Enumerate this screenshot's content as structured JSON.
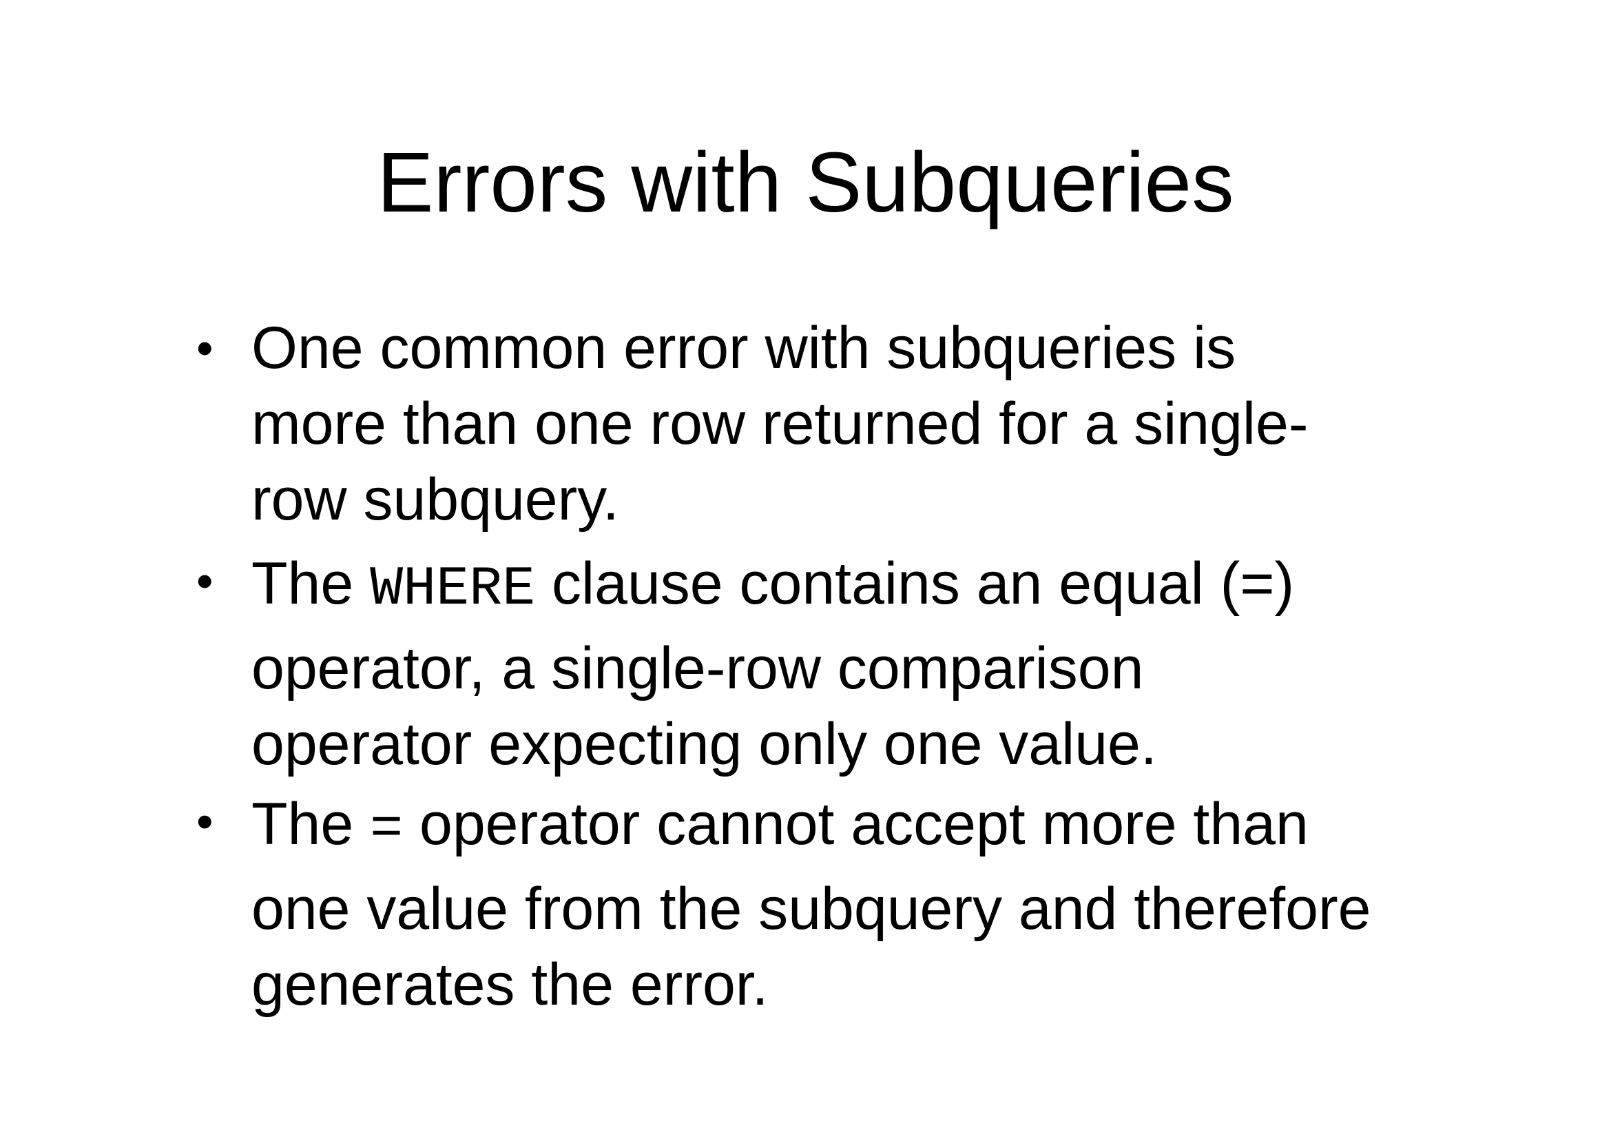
{
  "slide": {
    "title": "Errors with Subqueries",
    "bullets": [
      {
        "lines": [
          "One common error with subqueries is",
          "more than one row returned for a single-",
          "row subquery."
        ]
      },
      {
        "line1_before": "The ",
        "line1_code": "WHERE",
        "line1_after": " clause contains an equal (=)",
        "lines_rest": [
          "operator, a single-row comparison",
          "operator expecting only one value."
        ]
      },
      {
        "line1_before": "The ",
        "line1_code": "=",
        "line1_after": " operator cannot accept more than",
        "lines_rest": [
          "one value from the subquery and therefore",
          "generates the error."
        ]
      }
    ],
    "bullet_symbol": "•"
  }
}
